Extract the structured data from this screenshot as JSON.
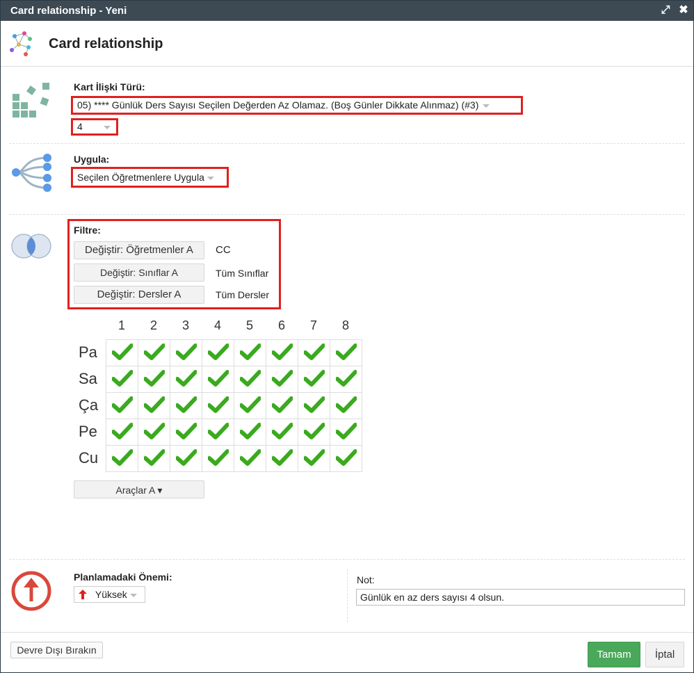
{
  "window": {
    "title": "Card relationship - Yeni",
    "maximize_glyph": "⤢",
    "close_glyph": "✖"
  },
  "header": {
    "title": "Card relationship"
  },
  "card_type": {
    "label": "Kart İlişki Türü:",
    "selected": "05) **** Günlük Ders Sayısı Seçilen Değerden Az Olamaz. (Boş Günler Dikkate Alınmaz) (#3)",
    "value": "4"
  },
  "apply": {
    "label": "Uygula:",
    "selected": "Seçilen Öğretmenlere Uygula"
  },
  "filter": {
    "label": "Filtre:",
    "rows": [
      {
        "button": "Değiştir: Öğretmenler A",
        "value": "CC"
      },
      {
        "button": "Değiştir: Sınıflar A",
        "value": "Tüm Sınıflar"
      },
      {
        "button": "Değiştir: Dersler A",
        "value": "Tüm Dersler"
      }
    ]
  },
  "grid": {
    "columns": [
      "1",
      "2",
      "3",
      "4",
      "5",
      "6",
      "7",
      "8"
    ],
    "rows": [
      "Pa",
      "Sa",
      "Ça",
      "Pe",
      "Cu"
    ],
    "all_checked": true,
    "check_color": "#3aaa1e"
  },
  "tools": {
    "button": "Araçlar A ▾"
  },
  "importance": {
    "label": "Planlamadaki Önemi:",
    "selected": "Yüksek",
    "arrow_color": "#e0201c"
  },
  "note": {
    "label": "Not:",
    "value": "Günlük en az ders sayısı 4 olsun."
  },
  "footer": {
    "disable_button": "Devre Dışı Bırakın",
    "ok_button": "Tamam",
    "cancel_button": "İptal",
    "ok_color": "#4aa85a"
  },
  "colors": {
    "titlebar": "#3d4a54",
    "highlight_border": "#e02020"
  }
}
